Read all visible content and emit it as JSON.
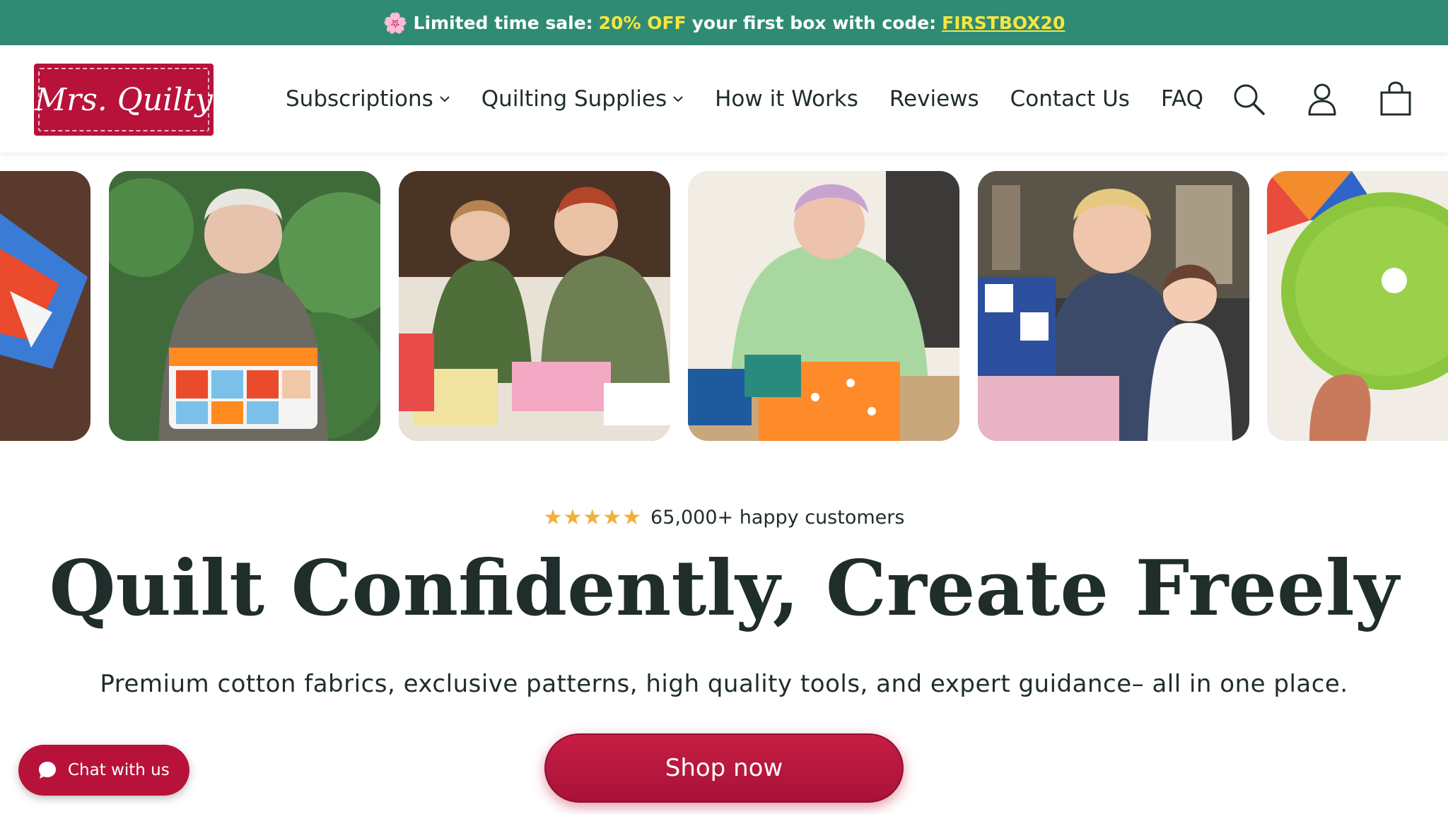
{
  "announcement": {
    "prefix": "Limited time sale:",
    "highlight": "20% OFF",
    "middle": "your first box with code:",
    "code": "FIRSTBOX20"
  },
  "logo": {
    "text": "Mrs. Quilty"
  },
  "nav": {
    "items": [
      {
        "label": "Subscriptions",
        "dropdown": true
      },
      {
        "label": "Quilting Supplies",
        "dropdown": true
      },
      {
        "label": "How it Works",
        "dropdown": false
      },
      {
        "label": "Reviews",
        "dropdown": false
      },
      {
        "label": "Contact Us",
        "dropdown": false
      },
      {
        "label": "FAQ",
        "dropdown": false
      }
    ]
  },
  "header_icons": [
    "search-icon",
    "account-icon",
    "cart-icon"
  ],
  "hero": {
    "stars": "★★★★★",
    "rating_text": "65,000+ happy customers",
    "headline": "Quilt Confidently, Create Freely",
    "subheadline": "Premium cotton fabrics, exclusive patterns, high quality tools, and expert guidance– all in one place.",
    "cta": "Shop now"
  },
  "chat": {
    "label": "Chat with us"
  },
  "colors": {
    "announcement_bg": "#2f8b73",
    "brand_red": "#b8123b",
    "highlight_yellow": "#f5e642",
    "star": "#f2b035",
    "text_dark": "#1f2d2b"
  }
}
